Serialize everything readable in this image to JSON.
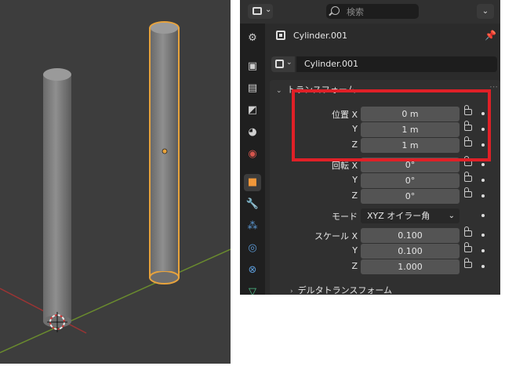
{
  "viewport": {
    "objects": [
      "Cylinder",
      "Cylinder.001"
    ],
    "colors": {
      "background": "#3d3d3d",
      "selection_outline": "#e8a33c",
      "x_axis": "#9b3434",
      "y_axis": "#6a8b2e"
    }
  },
  "topbar": {
    "editor_type_icon": "properties-editor-icon",
    "search_placeholder": "検索",
    "options_label": "⌄"
  },
  "tabs": [
    {
      "name": "tool-icon",
      "glyph": "⚙",
      "color": "#cfcfcf",
      "active": false
    },
    {
      "name": "render-icon",
      "glyph": "▣",
      "color": "#cfcfcf",
      "active": false
    },
    {
      "name": "output-icon",
      "glyph": "▤",
      "color": "#cfcfcf",
      "active": false
    },
    {
      "name": "view-layer-icon",
      "glyph": "◩",
      "color": "#cfcfcf",
      "active": false
    },
    {
      "name": "scene-icon",
      "glyph": "◕",
      "color": "#cfcfcf",
      "active": false
    },
    {
      "name": "world-icon",
      "glyph": "◉",
      "color": "#d4554c",
      "active": false
    },
    {
      "name": "object-icon",
      "glyph": "■",
      "color": "#f0973a",
      "active": true
    },
    {
      "name": "modifier-icon",
      "glyph": "🔧",
      "color": "#5c9bd8",
      "active": false
    },
    {
      "name": "particles-icon",
      "glyph": "⁂",
      "color": "#5c9bd8",
      "active": false
    },
    {
      "name": "physics-icon",
      "glyph": "◎",
      "color": "#5c9bd8",
      "active": false
    },
    {
      "name": "constraints-icon",
      "glyph": "⊗",
      "color": "#5c9bd8",
      "active": false
    },
    {
      "name": "data-icon",
      "glyph": "▽",
      "color": "#4fc18b",
      "active": false
    }
  ],
  "header": {
    "object_name": "Cylinder.001"
  },
  "name_field": {
    "value": "Cylinder.001"
  },
  "transform": {
    "title": "トランスフォーム",
    "location": [
      {
        "label": "位置 X",
        "value": "0 m"
      },
      {
        "label": "Y",
        "value": "1 m"
      },
      {
        "label": "Z",
        "value": "1 m"
      }
    ],
    "rotation": [
      {
        "label": "回転 X",
        "value": "0°"
      },
      {
        "label": "Y",
        "value": "0°"
      },
      {
        "label": "Z",
        "value": "0°"
      }
    ],
    "mode": {
      "label": "モード",
      "value": "XYZ オイラー角"
    },
    "scale": [
      {
        "label": "スケール X",
        "value": "0.100"
      },
      {
        "label": "Y",
        "value": "0.100"
      },
      {
        "label": "Z",
        "value": "1.000"
      }
    ]
  },
  "delta_transform": {
    "title": "デルタトランスフォーム"
  },
  "highlight": {
    "color": "#e02027"
  }
}
